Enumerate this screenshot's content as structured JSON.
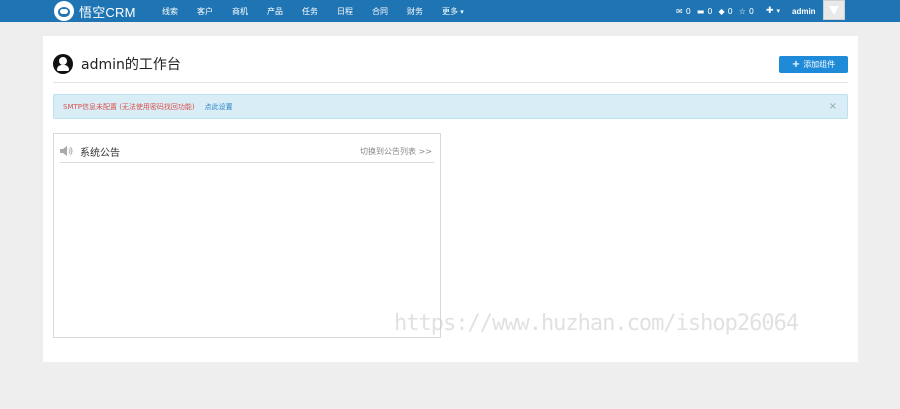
{
  "brand": {
    "name": "悟空CRM"
  },
  "nav": [
    "线索",
    "客户",
    "商机",
    "产品",
    "任务",
    "日程",
    "合同",
    "财务"
  ],
  "nav_more": "更多",
  "notifications": [
    {
      "icon": "mail-icon",
      "count": "0"
    },
    {
      "icon": "card-icon",
      "count": "0"
    },
    {
      "icon": "diamond-icon",
      "count": "0"
    },
    {
      "icon": "star-icon",
      "count": "0"
    }
  ],
  "user": {
    "name": "admin"
  },
  "page": {
    "title": "admin的工作台",
    "add_widget_label": "添加组件"
  },
  "alert": {
    "message": "SMTP信息未配置 (无法使用密码找回功能)",
    "link": "点此设置",
    "close": "×"
  },
  "widget": {
    "title": "系统公告",
    "switch_label": "切换到公告列表 >>"
  },
  "watermark": "https://www.huzhan.com/ishop26064",
  "colors": {
    "topbar": "#1f75b3",
    "primary_button": "#1f8bd8",
    "alert_bg": "#d9edf7",
    "warning_text": "#d9534f"
  }
}
